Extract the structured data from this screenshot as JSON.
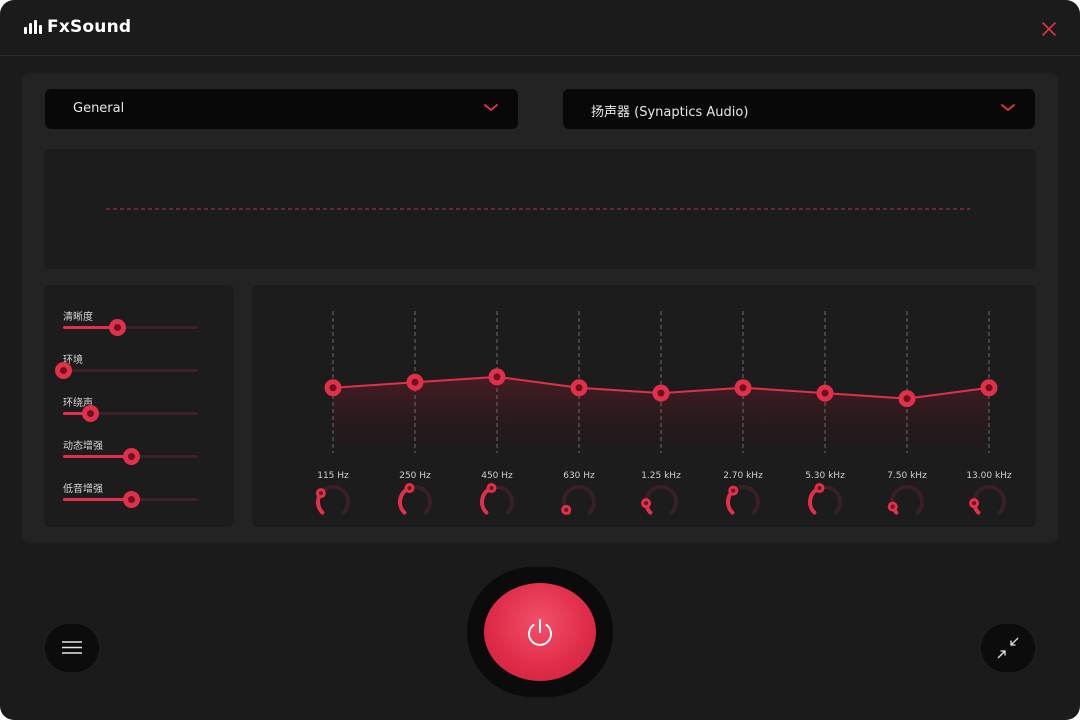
{
  "app": {
    "title": "FxSound"
  },
  "presets": {
    "selected": "General"
  },
  "output": {
    "selected": "扬声器 (Synaptics Audio)"
  },
  "effects": [
    {
      "name": "清晰度",
      "value": 0.4
    },
    {
      "name": "环境",
      "value": 0.0
    },
    {
      "name": "环绕声",
      "value": 0.2
    },
    {
      "name": "动态增强",
      "value": 0.5
    },
    {
      "name": "低音增强",
      "value": 0.5
    }
  ],
  "eq": {
    "bands": [
      {
        "label": "115 Hz",
        "level": 0.48,
        "knob": 0.3
      },
      {
        "label": "250 Hz",
        "level": 0.52,
        "knob": 0.42
      },
      {
        "label": "450 Hz",
        "level": 0.56,
        "knob": 0.42
      },
      {
        "label": "630 Hz",
        "level": 0.48,
        "knob": 0.05
      },
      {
        "label": "1.25 kHz",
        "level": 0.44,
        "knob": 0.15
      },
      {
        "label": "2.70 kHz",
        "level": 0.48,
        "knob": 0.35
      },
      {
        "label": "5.30 kHz",
        "level": 0.44,
        "knob": 0.42
      },
      {
        "label": "7.50 kHz",
        "level": 0.4,
        "knob": 0.1
      },
      {
        "label": "13.00 kHz",
        "level": 0.48,
        "knob": 0.15
      }
    ]
  },
  "colors": {
    "accent": "#e0304a",
    "background": "#1b1b1b",
    "panel": "#232323"
  },
  "icons": {
    "logo": "equalizer-bars-icon",
    "close": "close-icon",
    "dropdown": "chevron-down-icon",
    "menu": "hamburger-menu-icon",
    "power": "power-icon",
    "minimize": "compact-view-icon"
  }
}
